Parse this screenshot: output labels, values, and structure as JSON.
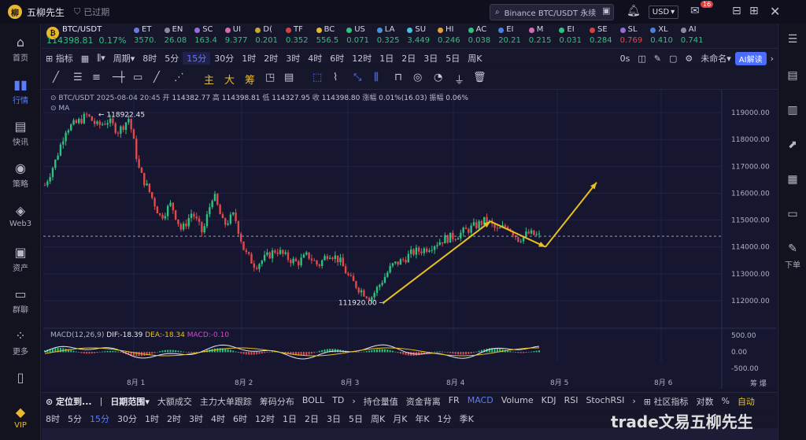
{
  "app": {
    "name": "五柳先生",
    "status": "已过期",
    "search_placeholder": "Binance BTC/USDT 永续",
    "currency": "USD",
    "mail_badge": "16"
  },
  "left_nav": [
    {
      "label": "首页",
      "icon": "home-icon"
    },
    {
      "label": "行情",
      "icon": "chart-bars-icon",
      "active": true
    },
    {
      "label": "快讯",
      "icon": "news-icon"
    },
    {
      "label": "策略",
      "icon": "robot-icon"
    },
    {
      "label": "Web3",
      "icon": "web3-icon"
    },
    {
      "label": "资产",
      "icon": "wallet-icon"
    },
    {
      "label": "群聊",
      "icon": "chat-icon"
    },
    {
      "label": "更多",
      "icon": "grid-icon"
    },
    {
      "label": "VIP",
      "icon": "diamond-icon"
    }
  ],
  "right_nav": {
    "down_label": "下单"
  },
  "main_coin": {
    "name": "BTC/USDT",
    "price": "114398.81",
    "change": "0.17%"
  },
  "tickers": [
    {
      "name": "ET",
      "price": "3570.",
      "color": "#2ec27e",
      "dot": "#6b7bd8"
    },
    {
      "name": "EN",
      "price": "26.08",
      "color": "#2ec27e",
      "dot": "#8a8aa0"
    },
    {
      "name": "SC",
      "price": "163.4",
      "color": "#2ec27e",
      "dot": "#9a6ad8"
    },
    {
      "name": "UI",
      "price": "9.377",
      "color": "#2ec27e",
      "dot": "#d86ab0"
    },
    {
      "name": "D(",
      "price": "0.201",
      "color": "#2ec27e",
      "dot": "#c8a830"
    },
    {
      "name": "TF",
      "price": "0.352",
      "color": "#2ec27e",
      "dot": "#d84040"
    },
    {
      "name": "BC",
      "price": "556.5",
      "color": "#2ec27e",
      "dot": "#e8b830"
    },
    {
      "name": "US",
      "price": "0.071",
      "color": "#2ec27e",
      "dot": "#2ec27e"
    },
    {
      "name": "LA",
      "price": "0.325",
      "color": "#2ec27e",
      "dot": "#4a90e0"
    },
    {
      "name": "SU",
      "price": "3.449",
      "color": "#2ec27e",
      "dot": "#4ac0e0"
    },
    {
      "name": "HI",
      "price": "0.246",
      "color": "#2ec27e",
      "dot": "#e8a030"
    },
    {
      "name": "AC",
      "price": "0.038",
      "color": "#2ec27e",
      "dot": "#2ec27e"
    },
    {
      "name": "EI",
      "price": "20.21",
      "color": "#2ec27e",
      "dot": "#4a80e0"
    },
    {
      "name": "M",
      "price": "0.215",
      "color": "#2ec27e",
      "dot": "#d86ab0"
    },
    {
      "name": "EI",
      "price": "0.031",
      "color": "#2ec27e",
      "dot": "#2ec27e"
    },
    {
      "name": "SE",
      "price": "0.284",
      "color": "#2ec27e",
      "dot": "#d84040"
    },
    {
      "name": "SL",
      "price": "0.769",
      "color": "#e04a4a",
      "dot": "#9a6ad8"
    },
    {
      "name": "XL",
      "price": "0.410",
      "color": "#2ec27e",
      "dot": "#4a80e0"
    },
    {
      "name": "AI",
      "price": "0.741",
      "color": "#2ec27e",
      "dot": "#8a8aa0"
    }
  ],
  "interval_bar": {
    "indicator_label": "指标",
    "period_label": "周期",
    "intervals": [
      "8时",
      "5分",
      "15分",
      "30分",
      "1时",
      "2时",
      "3时",
      "4时",
      "6时",
      "12时",
      "1日",
      "2日",
      "3日",
      "5日",
      "周K"
    ],
    "selected": "15分",
    "countdown": "0s",
    "not_named": "未命名",
    "ai_label": "AI解读"
  },
  "draw_bar": {
    "gold_labels": [
      "主",
      "大",
      "筹"
    ]
  },
  "chart_header": {
    "symbol": "BTC/USDT",
    "date": "2025-08-04 20:45",
    "open_label": "开",
    "open": "114382.77",
    "high_label": "高",
    "high": "114398.81",
    "low_label": "低",
    "low": "114327.95",
    "close_label": "收",
    "close": "114398.80",
    "change_label": "涨幅",
    "change": "0.01%(16.03)",
    "amp_label": "振幅",
    "amp": "0.06%",
    "ma_label": "MA",
    "macd_label": "MACD(12,26,9)",
    "dif_label": "DIF:",
    "dif": "-18.39",
    "dea_label": "DEA:",
    "dea": "-18.34",
    "macd_val_label": "MACD:",
    "macd_val": "-0.10"
  },
  "chart_data": {
    "type": "candlestick",
    "price_axis": [
      "119000.00",
      "118000.00",
      "117000.00",
      "116000.00",
      "115000.00",
      "114000.00",
      "113000.00",
      "112000.00"
    ],
    "ylim": [
      111500,
      119500
    ],
    "dates": [
      "8月 1",
      "8月 2",
      "8月 3",
      "8月 4",
      "8月 5",
      "8月 6"
    ],
    "high_annotation": "118922.45",
    "low_annotation": "111920.00",
    "current_price": 114398.81,
    "close_path": [
      116300,
      117200,
      118400,
      118600,
      118900,
      118500,
      118700,
      118300,
      118800,
      116800,
      116000,
      115100,
      115600,
      114600,
      115300,
      114500,
      116000,
      114800,
      115200,
      113800,
      113300,
      113600,
      113900,
      113600,
      113400,
      113700,
      113300,
      113800,
      113500,
      112800,
      112400,
      112100,
      112700,
      113300,
      113500,
      113800,
      113900,
      114100,
      114300,
      114400,
      114600,
      114800,
      115000,
      114600,
      114800,
      114300,
      114500,
      114400
    ],
    "macd_axis": [
      "500.00",
      "0.00",
      "-500.00"
    ],
    "annotations": [
      {
        "type": "arrow",
        "from": [
          "8月 3",
          111920
        ],
        "to": [
          "8月 4",
          114950
        ],
        "color": "#e8c020"
      },
      {
        "type": "arrow",
        "from": [
          "8月 4",
          114950
        ],
        "to": [
          "8月 4",
          114000
        ],
        "color": "#e8c020"
      },
      {
        "type": "arrow",
        "from": [
          "8月 4",
          114000
        ],
        "to": [
          "8月 5",
          116400
        ],
        "color": "#e8c020"
      }
    ]
  },
  "bottom_bar": {
    "locate_label": "定位到...",
    "date_range_label": "日期范围",
    "tools": [
      "大额成交",
      "主力大单跟踪",
      "筹码分布",
      "BOLL",
      "TD"
    ],
    "indicators": [
      "持仓量值",
      "资金背离",
      "FR",
      "MACD",
      "Volume",
      "KDJ",
      "RSI",
      "StochRSI"
    ],
    "selected_indicator": "MACD",
    "community_label": "社区指标",
    "log_label": "对数",
    "pct_label": "%",
    "auto_label": "自动",
    "right_small": "筹 爆"
  },
  "bottom_intervals": [
    "8时",
    "5分",
    "15分",
    "30分",
    "1时",
    "2时",
    "3时",
    "4时",
    "6时",
    "12时",
    "1日",
    "2日",
    "3日",
    "5日",
    "周K",
    "月K",
    "年K",
    "1分",
    "季K"
  ],
  "watermark": "trade文易五柳先生"
}
